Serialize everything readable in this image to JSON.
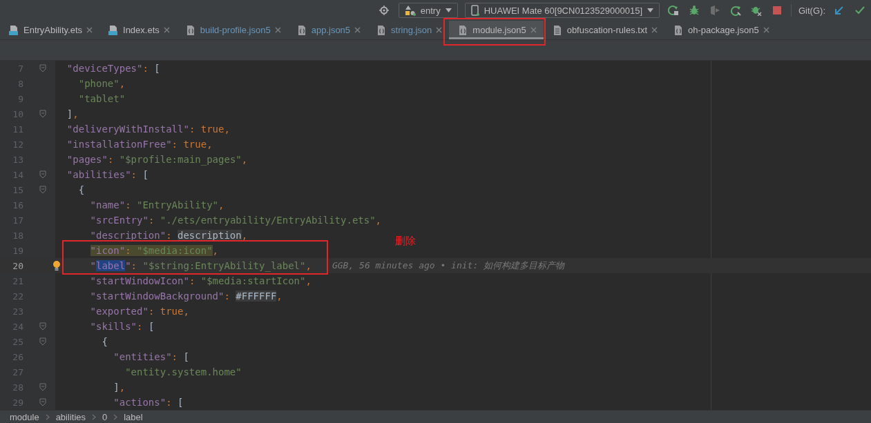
{
  "toolbar": {
    "run_config": "entry",
    "device": "HUAWEI Mate 60[9CN0123529000015]",
    "git_label": "Git(G):"
  },
  "tabs": [
    {
      "label": "EntryAbility.ets",
      "kind": "ets",
      "selected": false,
      "changed": false,
      "annotated": false
    },
    {
      "label": "Index.ets",
      "kind": "ets",
      "selected": false,
      "changed": false,
      "annotated": false
    },
    {
      "label": "build-profile.json5",
      "kind": "json",
      "selected": false,
      "changed": true,
      "annotated": false
    },
    {
      "label": "app.json5",
      "kind": "json",
      "selected": false,
      "changed": true,
      "annotated": false
    },
    {
      "label": "string.json",
      "kind": "json",
      "selected": false,
      "changed": true,
      "annotated": false
    },
    {
      "label": "module.json5",
      "kind": "json",
      "selected": true,
      "changed": false,
      "annotated": true
    },
    {
      "label": "obfuscation-rules.txt",
      "kind": "txt",
      "selected": false,
      "changed": false,
      "annotated": false
    },
    {
      "label": "oh-package.json5",
      "kind": "json",
      "selected": false,
      "changed": false,
      "annotated": false
    }
  ],
  "lines": [
    {
      "number": "7",
      "fold": true,
      "current": false,
      "bulb": false,
      "boxed": false,
      "tokens": [
        {
          "kind": "key",
          "text": "  \"deviceTypes\""
        },
        {
          "kind": "op",
          "text": ": "
        },
        {
          "kind": "br",
          "text": "["
        }
      ]
    },
    {
      "number": "8",
      "fold": false,
      "current": false,
      "bulb": false,
      "boxed": false,
      "tokens": [
        {
          "kind": "str",
          "text": "    \"phone\""
        },
        {
          "kind": "op",
          "text": ","
        }
      ]
    },
    {
      "number": "9",
      "fold": false,
      "current": false,
      "bulb": false,
      "boxed": false,
      "tokens": [
        {
          "kind": "str",
          "text": "    \"tablet\""
        }
      ]
    },
    {
      "number": "10",
      "fold": true,
      "current": false,
      "bulb": false,
      "boxed": false,
      "tokens": [
        {
          "kind": "br",
          "text": "  ]"
        },
        {
          "kind": "op",
          "text": ","
        }
      ]
    },
    {
      "number": "11",
      "fold": false,
      "current": false,
      "bulb": false,
      "boxed": false,
      "tokens": [
        {
          "kind": "key",
          "text": "  \"deliveryWithInstall\""
        },
        {
          "kind": "op",
          "text": ": "
        },
        {
          "kind": "kw",
          "text": "true"
        },
        {
          "kind": "op",
          "text": ","
        }
      ]
    },
    {
      "number": "12",
      "fold": false,
      "current": false,
      "bulb": false,
      "boxed": false,
      "tokens": [
        {
          "kind": "key",
          "text": "  \"installationFree\""
        },
        {
          "kind": "op",
          "text": ": "
        },
        {
          "kind": "kw",
          "text": "true"
        },
        {
          "kind": "op",
          "text": ","
        }
      ]
    },
    {
      "number": "13",
      "fold": false,
      "current": false,
      "bulb": false,
      "boxed": false,
      "tokens": [
        {
          "kind": "key",
          "text": "  \"pages\""
        },
        {
          "kind": "op",
          "text": ": "
        },
        {
          "kind": "str",
          "text": "\"$profile:main_pages\""
        },
        {
          "kind": "op",
          "text": ","
        }
      ]
    },
    {
      "number": "14",
      "fold": true,
      "current": false,
      "bulb": false,
      "boxed": false,
      "tokens": [
        {
          "kind": "key",
          "text": "  \"abilities\""
        },
        {
          "kind": "op",
          "text": ": "
        },
        {
          "kind": "br",
          "text": "["
        }
      ]
    },
    {
      "number": "15",
      "fold": true,
      "current": false,
      "bulb": false,
      "boxed": false,
      "tokens": [
        {
          "kind": "br",
          "text": "    {"
        }
      ]
    },
    {
      "number": "16",
      "fold": false,
      "current": false,
      "bulb": false,
      "boxed": false,
      "tokens": [
        {
          "kind": "key",
          "text": "      \"name\""
        },
        {
          "kind": "op",
          "text": ": "
        },
        {
          "kind": "str",
          "text": "\"EntryAbility\""
        },
        {
          "kind": "op",
          "text": ","
        }
      ]
    },
    {
      "number": "17",
      "fold": false,
      "current": false,
      "bulb": false,
      "boxed": false,
      "tokens": [
        {
          "kind": "key",
          "text": "      \"srcEntry\""
        },
        {
          "kind": "op",
          "text": ": "
        },
        {
          "kind": "str",
          "text": "\"./ets/entryability/EntryAbility.ets\""
        },
        {
          "kind": "op",
          "text": ","
        }
      ]
    },
    {
      "number": "18",
      "fold": false,
      "current": false,
      "bulb": false,
      "boxed": false,
      "tokens": [
        {
          "kind": "key",
          "text": "      \"description\""
        },
        {
          "kind": "op",
          "text": ": "
        },
        {
          "kind": "inlay",
          "text": "description"
        },
        {
          "kind": "op",
          "text": ","
        }
      ]
    },
    {
      "number": "19",
      "fold": false,
      "current": false,
      "bulb": false,
      "boxed": true,
      "tokens": [
        {
          "kind": "key_match",
          "text": "      \"icon\""
        },
        {
          "kind": "op_match",
          "text": ": "
        },
        {
          "kind": "str_match",
          "text": "\"$media:icon\""
        },
        {
          "kind": "op",
          "text": ","
        }
      ]
    },
    {
      "number": "20",
      "fold": false,
      "current": true,
      "bulb": true,
      "boxed": true,
      "blame": "GGB, 56 minutes ago • init: 如何构建多目标产物",
      "tokens": [
        {
          "kind": "key",
          "text": "      \""
        },
        {
          "kind": "key_selected",
          "text": "label"
        },
        {
          "kind": "key",
          "text": "\""
        },
        {
          "kind": "op",
          "text": ": "
        },
        {
          "kind": "str",
          "text": "\"$string:EntryAbility_label\""
        },
        {
          "kind": "op",
          "text": ","
        }
      ]
    },
    {
      "number": "21",
      "fold": false,
      "current": false,
      "bulb": false,
      "boxed": false,
      "tokens": [
        {
          "kind": "key",
          "text": "      \"startWindowIcon\""
        },
        {
          "kind": "op",
          "text": ": "
        },
        {
          "kind": "str",
          "text": "\"$media:startIcon\""
        },
        {
          "kind": "op",
          "text": ","
        }
      ]
    },
    {
      "number": "22",
      "fold": false,
      "current": false,
      "bulb": false,
      "boxed": false,
      "tokens": [
        {
          "kind": "key",
          "text": "      \"startWindowBackground\""
        },
        {
          "kind": "op",
          "text": ": "
        },
        {
          "kind": "inlay",
          "text": "#FFFFFF"
        },
        {
          "kind": "op",
          "text": ","
        }
      ]
    },
    {
      "number": "23",
      "fold": false,
      "current": false,
      "bulb": false,
      "boxed": false,
      "tokens": [
        {
          "kind": "key",
          "text": "      \"exported\""
        },
        {
          "kind": "op",
          "text": ": "
        },
        {
          "kind": "kw",
          "text": "true"
        },
        {
          "kind": "op",
          "text": ","
        }
      ]
    },
    {
      "number": "24",
      "fold": true,
      "current": false,
      "bulb": false,
      "boxed": false,
      "tokens": [
        {
          "kind": "key",
          "text": "      \"skills\""
        },
        {
          "kind": "op",
          "text": ": "
        },
        {
          "kind": "br",
          "text": "["
        }
      ]
    },
    {
      "number": "25",
      "fold": true,
      "current": false,
      "bulb": false,
      "boxed": false,
      "tokens": [
        {
          "kind": "br",
          "text": "        {"
        }
      ]
    },
    {
      "number": "26",
      "fold": false,
      "current": false,
      "bulb": false,
      "boxed": false,
      "tokens": [
        {
          "kind": "key",
          "text": "          \"entities\""
        },
        {
          "kind": "op",
          "text": ": "
        },
        {
          "kind": "br",
          "text": "["
        }
      ]
    },
    {
      "number": "27",
      "fold": false,
      "current": false,
      "bulb": false,
      "boxed": false,
      "tokens": [
        {
          "kind": "str",
          "text": "            \"entity.system.home\""
        }
      ]
    },
    {
      "number": "28",
      "fold": true,
      "current": false,
      "bulb": false,
      "boxed": false,
      "tokens": [
        {
          "kind": "br",
          "text": "          ]"
        },
        {
          "kind": "op",
          "text": ","
        }
      ]
    },
    {
      "number": "29",
      "fold": true,
      "current": false,
      "bulb": false,
      "boxed": false,
      "tokens": [
        {
          "kind": "key",
          "text": "          \"actions\""
        },
        {
          "kind": "op",
          "text": ": "
        },
        {
          "kind": "br",
          "text": "["
        }
      ]
    }
  ],
  "annotation": "删除",
  "breadcrumbs": [
    "module",
    "abilities",
    "0",
    "label"
  ]
}
